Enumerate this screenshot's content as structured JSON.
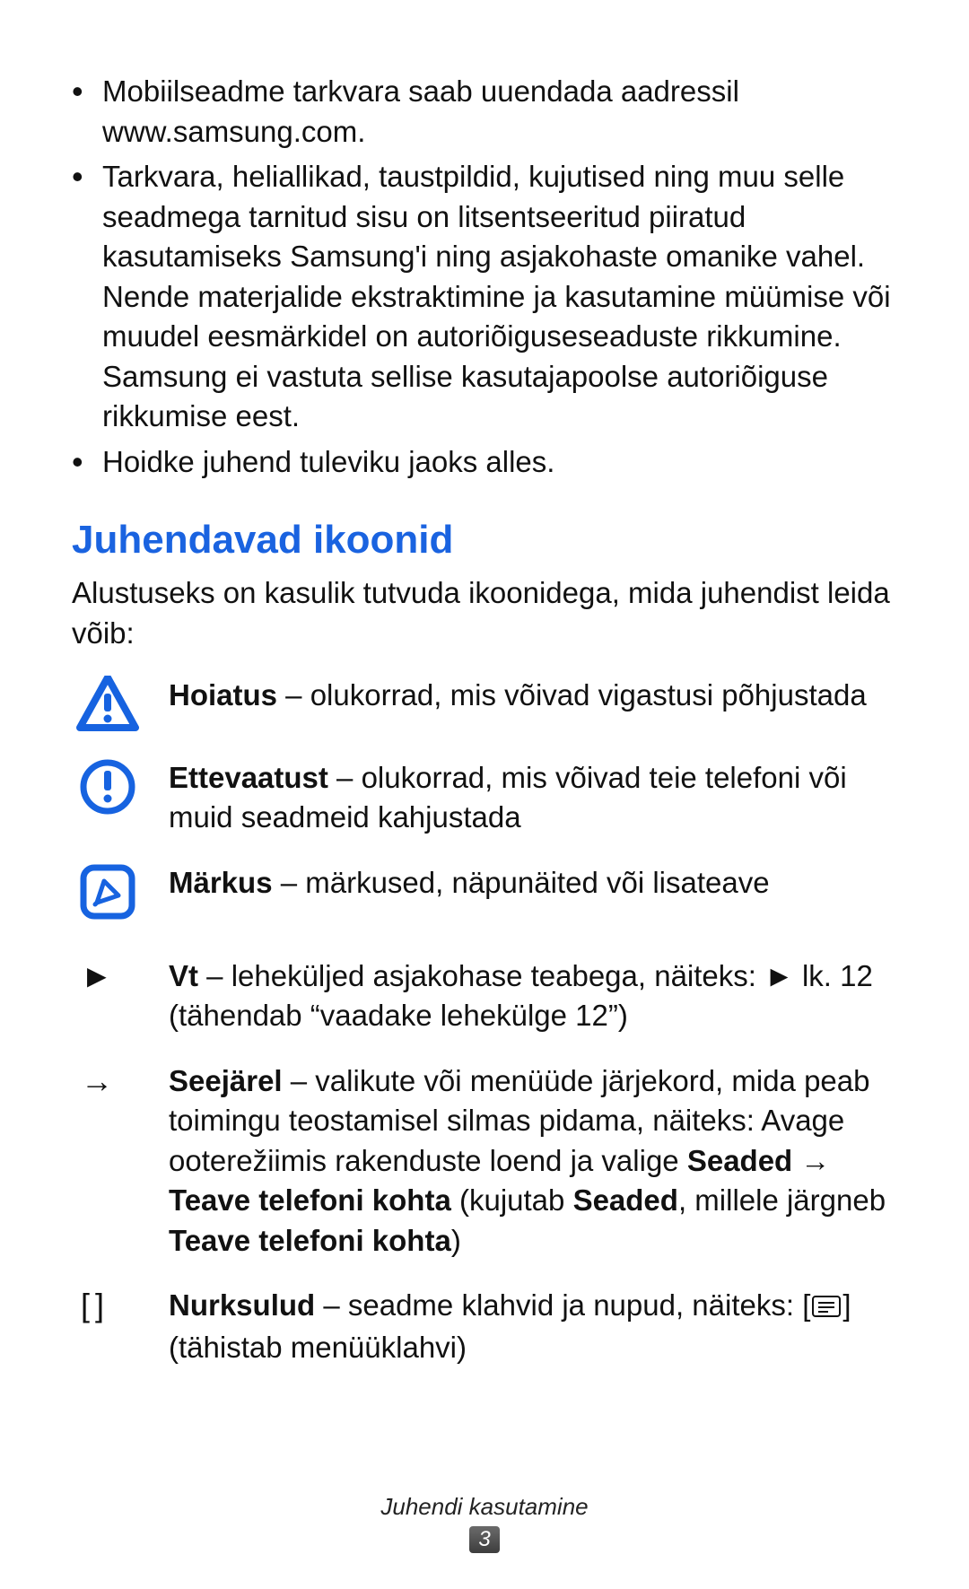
{
  "bullets": [
    "Mobiilseadme tarkvara saab uuendada aadressil www.samsung.com.",
    "Tarkvara, heliallikad, taustpildid, kujutised ning muu selle seadmega tarnitud sisu on litsentseeritud piiratud kasutamiseks Samsung'i ning asjakohaste omanike vahel. Nende materjalide ekstraktimine ja kasutamine müümise või muudel eesmärkidel on autoriõiguseseaduste rikkumine. Samsung ei vastuta sellise kasutajapoolse autoriõiguse rikkumise eest.",
    "Hoidke juhend tuleviku jaoks alles."
  ],
  "section_title": "Juhendavad ikoonid",
  "intro": "Alustuseks on kasulik tutvuda ikoonidega, mida juhendist leida võib:",
  "rows": {
    "warning": {
      "label": "Hoiatus",
      "rest": " – olukorrad, mis võivad vigastusi põhjustada"
    },
    "caution": {
      "label": "Ettevaatust",
      "rest": " – olukorrad, mis võivad teie telefoni või muid seadmeid kahjustada"
    },
    "note": {
      "label": "Märkus",
      "rest": " – märkused, näpunäited või lisateave"
    },
    "see": {
      "symbol": "►",
      "label": "Vt",
      "rest": " – leheküljed asjakohase teabega, näiteks: ► lk. 12 (tähendab “vaadake lehekülge 12”)"
    },
    "then": {
      "symbol": "→",
      "label": "Seejärel",
      "part1": " – valikute või menüüde järjekord, mida peab toimingu teostamisel silmas pidama, näiteks: Avage ooterežiimis rakenduste loend ja valige ",
      "bold1": "Seaded",
      "sep1": " → ",
      "bold2": "Teave telefoni kohta",
      "part2": " (kujutab ",
      "bold3": "Seaded",
      "part3": ", millele järgneb ",
      "bold4": "Teave telefoni kohta",
      "part4": ")"
    },
    "brackets": {
      "symbol": "[    ]",
      "label": "Nurksulud",
      "part1": " – seadme klahvid ja nupud, näiteks: [",
      "part2": "] (tähistab menüüklahvi)"
    }
  },
  "footer": {
    "title": "Juhendi kasutamine",
    "page": "3"
  }
}
